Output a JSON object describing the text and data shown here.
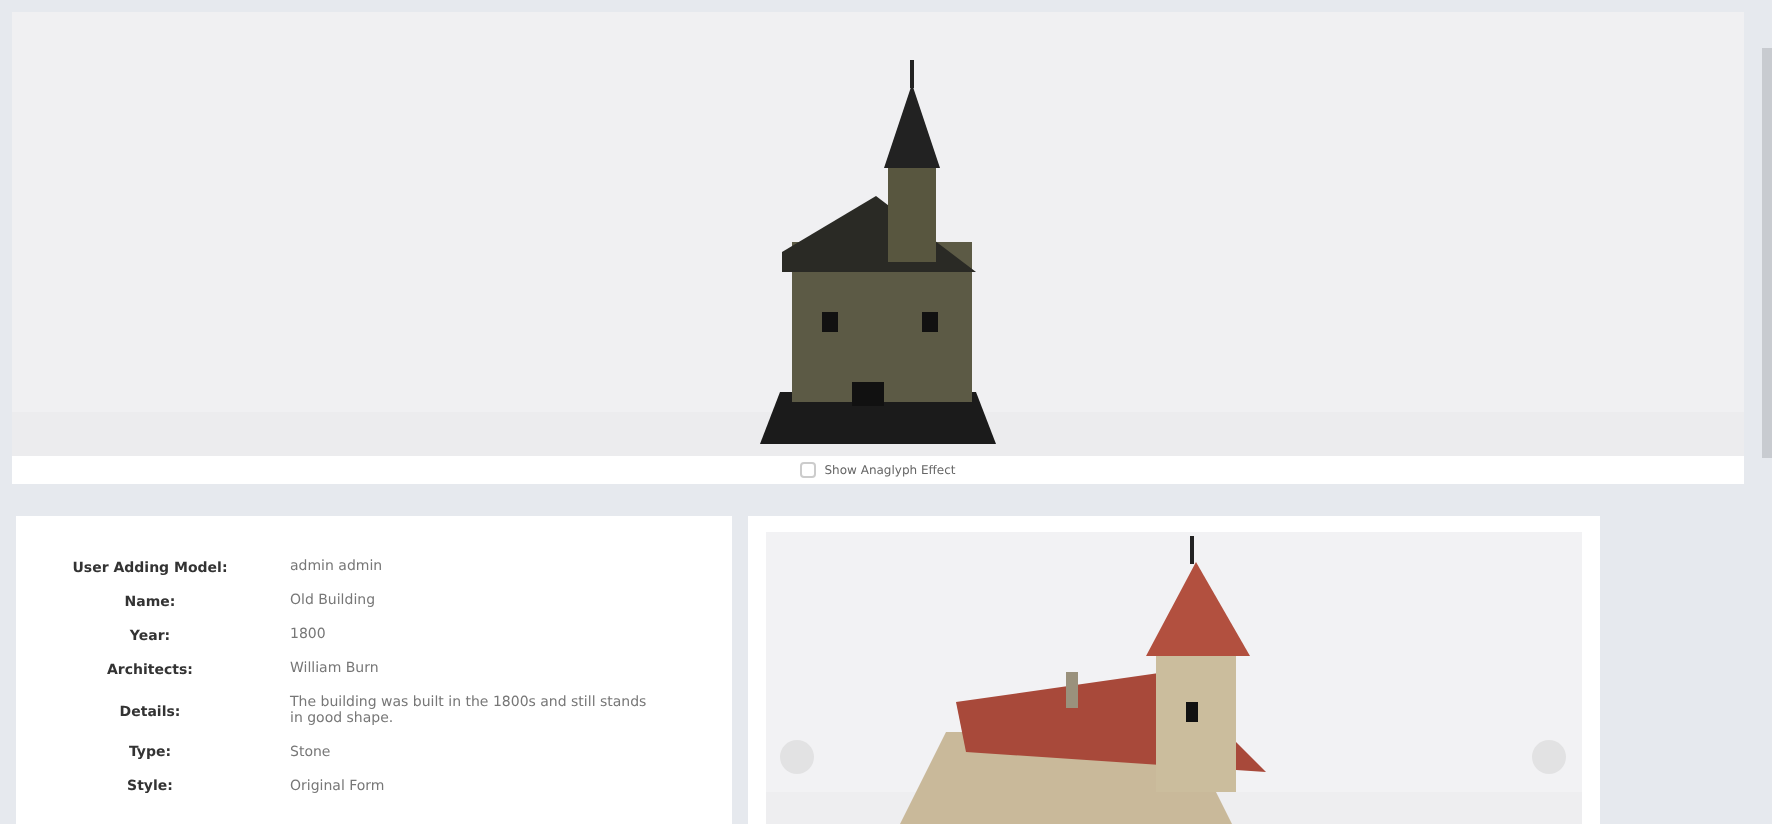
{
  "viewer": {
    "kind": "picture",
    "anaglyph": {
      "label": "Show Anaglyph Effect",
      "checked": false
    }
  },
  "details": [
    {
      "label": "User Adding Model:",
      "value": "admin admin"
    },
    {
      "label": "Name:",
      "value": "Old Building"
    },
    {
      "label": "Year:",
      "value": "1800"
    },
    {
      "label": "Architects:",
      "value": "William Burn"
    },
    {
      "label": "Details:",
      "value": "The building was built in the 1800s and still stands in good shape."
    },
    {
      "label": "Type:",
      "value": "Stone"
    },
    {
      "label": "Style:",
      "value": "Original Form"
    }
  ]
}
